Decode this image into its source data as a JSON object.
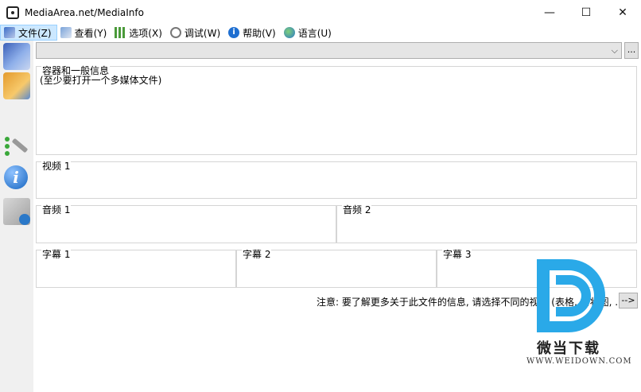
{
  "window": {
    "title": "MediaArea.net/MediaInfo",
    "minimize_glyph": "—",
    "maximize_glyph": "☐",
    "close_glyph": "✕"
  },
  "menu": {
    "items": [
      {
        "label": "文件(Z)",
        "icon": "file-icon"
      },
      {
        "label": "查看(Y)",
        "icon": "view-icon"
      },
      {
        "label": "选项(X)",
        "icon": "options-icon"
      },
      {
        "label": "调试(W)",
        "icon": "debug-icon"
      },
      {
        "label": "帮助(V)",
        "icon": "help-icon"
      },
      {
        "label": "语言(U)",
        "icon": "language-icon"
      }
    ]
  },
  "sidebar": {
    "buttons": [
      "easy-view-icon",
      "sheet-view-icon",
      "tree-view-icon",
      "info-icon",
      "export-icon"
    ]
  },
  "file_combo": {
    "value": "",
    "arrow": "⌵",
    "browse_label": "..."
  },
  "general": {
    "label": "容器和一般信息",
    "body": "(至少要打开一个多媒体文件)"
  },
  "video": {
    "label": "视频 1"
  },
  "audio": [
    "音频 1",
    "音频 2"
  ],
  "subtitles": [
    "字幕 1",
    "字幕 2",
    "字幕 3"
  ],
  "footer": {
    "note": "注意: 要了解更多关于此文件的信息, 请选择不同的视图 (表格, 树状图, ...)",
    "go_label": "-->"
  },
  "watermark": {
    "cn": "微当下载",
    "en": "WWW.WEIDOWN.COM"
  }
}
